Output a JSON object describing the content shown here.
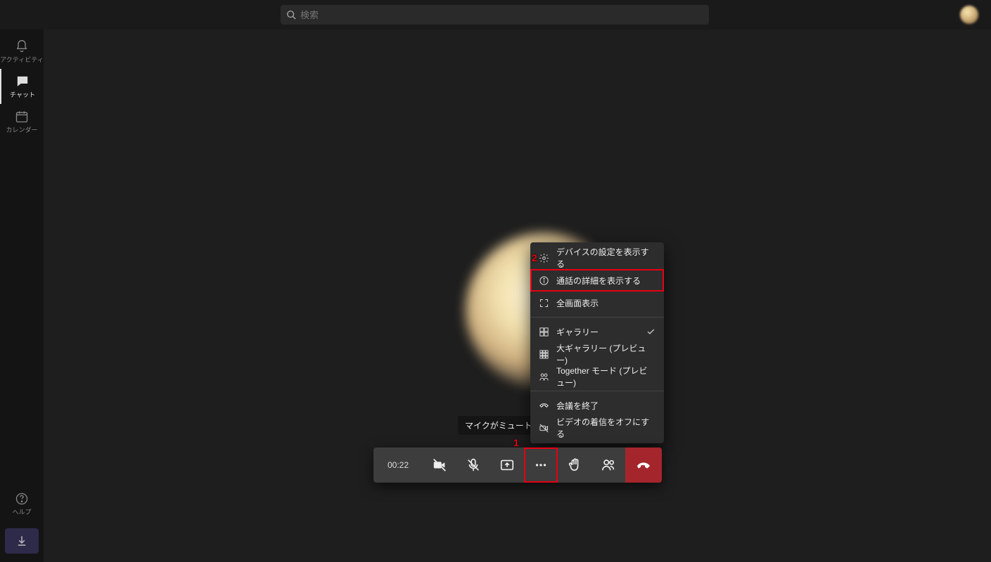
{
  "search": {
    "placeholder": "検索"
  },
  "rail": {
    "items": [
      {
        "id": "activity",
        "label": "アクティビティ"
      },
      {
        "id": "chat",
        "label": "チャット"
      },
      {
        "id": "calendar",
        "label": "カレンダー"
      }
    ],
    "help_label": "ヘルプ"
  },
  "call": {
    "timer": "00:22",
    "mute_banner": "マイクがミュートにな"
  },
  "menu": {
    "items": [
      {
        "id": "device-settings",
        "label": "デバイスの設定を表示する"
      },
      {
        "id": "call-details",
        "label": "通話の詳細を表示する"
      },
      {
        "id": "fullscreen",
        "label": "全画面表示"
      },
      {
        "id": "gallery",
        "label": "ギャラリー",
        "checked": true
      },
      {
        "id": "large-gallery",
        "label": "大ギャラリー (プレビュー)"
      },
      {
        "id": "together",
        "label": "Together モード (プレビュー)"
      },
      {
        "id": "end-meeting",
        "label": "会議を終了"
      },
      {
        "id": "incoming-video-off",
        "label": "ビデオの着信をオフにする"
      }
    ]
  },
  "annotations": {
    "one": "1",
    "two": "2"
  }
}
